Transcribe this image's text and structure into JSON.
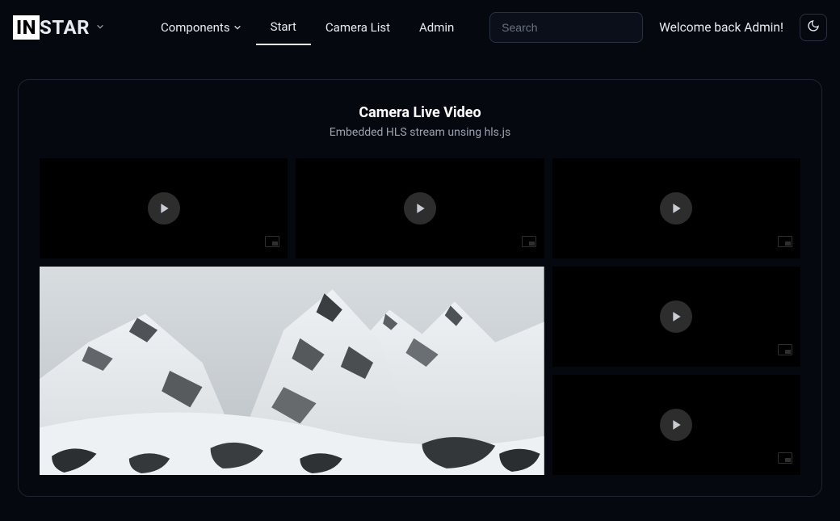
{
  "header": {
    "logo_prefix": "IN",
    "logo_suffix": "STAR",
    "nav": {
      "components": "Components",
      "start": "Start",
      "camera_list": "Camera List",
      "admin": "Admin"
    },
    "search_placeholder": "Search",
    "welcome": "Welcome back Admin!"
  },
  "card": {
    "title": "Camera Live Video",
    "subtitle": "Embedded HLS stream unsing hls.js"
  }
}
